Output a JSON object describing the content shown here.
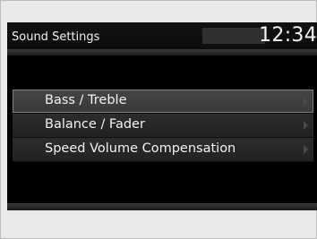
{
  "header": {
    "title": "Sound Settings",
    "clock": "12:34"
  },
  "menu": {
    "items": [
      {
        "label": "Bass / Treble",
        "selected": true,
        "icon": "chevron-right-icon"
      },
      {
        "label": "Balance / Fader",
        "selected": false,
        "icon": "chevron-right-icon"
      },
      {
        "label": "Speed Volume Compensation",
        "selected": false,
        "icon": "chevron-right-icon"
      }
    ]
  },
  "colors": {
    "screen_bg": "#000000",
    "item_bg": "#262626",
    "item_selected_bg": "#404040",
    "text": "#f2f2f2",
    "outer_bg": "#e9e9e9"
  }
}
